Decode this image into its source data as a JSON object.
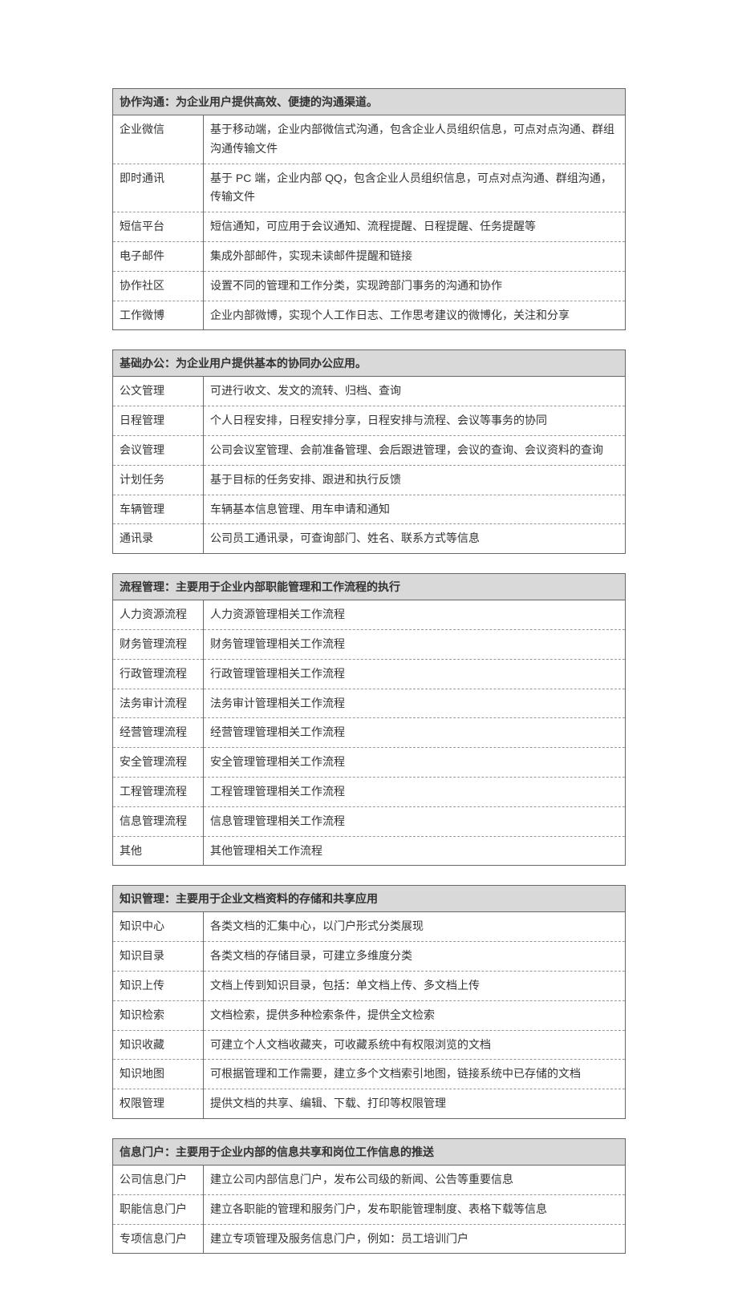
{
  "sections": [
    {
      "header": "协作沟通：为企业用户提供高效、便捷的沟通渠道。",
      "rows": [
        {
          "label": "企业微信",
          "desc": "基于移动端，企业内部微信式沟通，包含企业人员组织信息，可点对点沟通、群组沟通传输文件"
        },
        {
          "label": "即时通讯",
          "desc": "基于 PC 端，企业内部 QQ，包含企业人员组织信息，可点对点沟通、群组沟通，传输文件"
        },
        {
          "label": "短信平台",
          "desc": "短信通知，可应用于会议通知、流程提醒、日程提醒、任务提醒等"
        },
        {
          "label": "电子邮件",
          "desc": "集成外部邮件，实现未读邮件提醒和链接"
        },
        {
          "label": "协作社区",
          "desc": "设置不同的管理和工作分类，实现跨部门事务的沟通和协作"
        },
        {
          "label": "工作微博",
          "desc": "企业内部微博，实现个人工作日志、工作思考建议的微博化，关注和分享"
        }
      ]
    },
    {
      "header": "基础办公：为企业用户提供基本的协同办公应用。",
      "rows": [
        {
          "label": "公文管理",
          "desc": "可进行收文、发文的流转、归档、查询"
        },
        {
          "label": "日程管理",
          "desc": "个人日程安排，日程安排分享，日程安排与流程、会议等事务的协同"
        },
        {
          "label": "会议管理",
          "desc": "公司会议室管理、会前准备管理、会后跟进管理，会议的查询、会议资料的查询"
        },
        {
          "label": "计划任务",
          "desc": "基于目标的任务安排、跟进和执行反馈"
        },
        {
          "label": "车辆管理",
          "desc": "车辆基本信息管理、用车申请和通知"
        },
        {
          "label": "通讯录",
          "desc": "公司员工通讯录，可查询部门、姓名、联系方式等信息"
        }
      ]
    },
    {
      "header": "流程管理：主要用于企业内部职能管理和工作流程的执行",
      "rows": [
        {
          "label": "人力资源流程",
          "desc": "人力资源管理相关工作流程"
        },
        {
          "label": "财务管理流程",
          "desc": "财务管理管理相关工作流程"
        },
        {
          "label": "行政管理流程",
          "desc": "行政管理管理相关工作流程"
        },
        {
          "label": "法务审计流程",
          "desc": "法务审计管理相关工作流程"
        },
        {
          "label": "经营管理流程",
          "desc": "经营管理管理相关工作流程"
        },
        {
          "label": "安全管理流程",
          "desc": "安全管理管理相关工作流程"
        },
        {
          "label": "工程管理流程",
          "desc": "工程管理管理相关工作流程"
        },
        {
          "label": "信息管理流程",
          "desc": "信息管理管理相关工作流程"
        },
        {
          "label": "其他",
          "desc": "其他管理相关工作流程"
        }
      ]
    },
    {
      "header": "知识管理：主要用于企业文档资料的存储和共享应用",
      "rows": [
        {
          "label": "知识中心",
          "desc": "各类文档的汇集中心，以门户形式分类展现"
        },
        {
          "label": "知识目录",
          "desc": "各类文档的存储目录，可建立多维度分类"
        },
        {
          "label": "知识上传",
          "desc": "文档上传到知识目录，包括：单文档上传、多文档上传"
        },
        {
          "label": "知识检索",
          "desc": "文档检索，提供多种检索条件，提供全文检索"
        },
        {
          "label": "知识收藏",
          "desc": "可建立个人文档收藏夹，可收藏系统中有权限浏览的文档"
        },
        {
          "label": "知识地图",
          "desc": "可根据管理和工作需要，建立多个文档索引地图，链接系统中已存储的文档"
        },
        {
          "label": "权限管理",
          "desc": "提供文档的共享、编辑、下载、打印等权限管理"
        }
      ]
    },
    {
      "header": "信息门户：主要用于企业内部的信息共享和岗位工作信息的推送",
      "rows": [
        {
          "label": "公司信息门户",
          "desc": "建立公司内部信息门户，发布公司级的新闻、公告等重要信息"
        },
        {
          "label": "职能信息门户",
          "desc": "建立各职能的管理和服务门户，发布职能管理制度、表格下载等信息"
        },
        {
          "label": "专项信息门户",
          "desc": "建立专项管理及服务信息门户，例如：员工培训门户"
        }
      ]
    }
  ]
}
